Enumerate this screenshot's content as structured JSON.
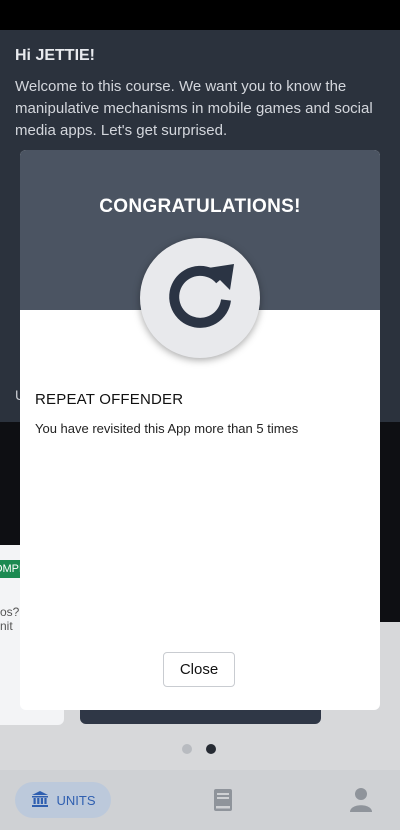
{
  "background": {
    "greeting": "Hi JETTIE!",
    "welcome": "Welcome to this course. We want you to know the manipulative mechanisms in mobile games and social media apps. Let's get surprised.",
    "units_peek": "U",
    "left_card_badge": "COMPLETE",
    "left_card_text_1": "os?",
    "left_card_text_2": "nit"
  },
  "modal": {
    "title": "CONGRATULATIONS!",
    "icon": "redo-icon",
    "achievement_title": "REPEAT OFFENDER",
    "achievement_desc": "You have revisited this App more than 5 times",
    "close_label": "Close"
  },
  "pager": {
    "count": 2,
    "active_index": 1
  },
  "nav": {
    "units_label": "UNITS",
    "units_icon": "bank-icon",
    "book_icon": "book-icon",
    "profile_icon": "person-icon"
  },
  "colors": {
    "modal_header": "#4b5462",
    "accent_blue": "#2f5fb0",
    "complete_green": "#1b8a52"
  }
}
